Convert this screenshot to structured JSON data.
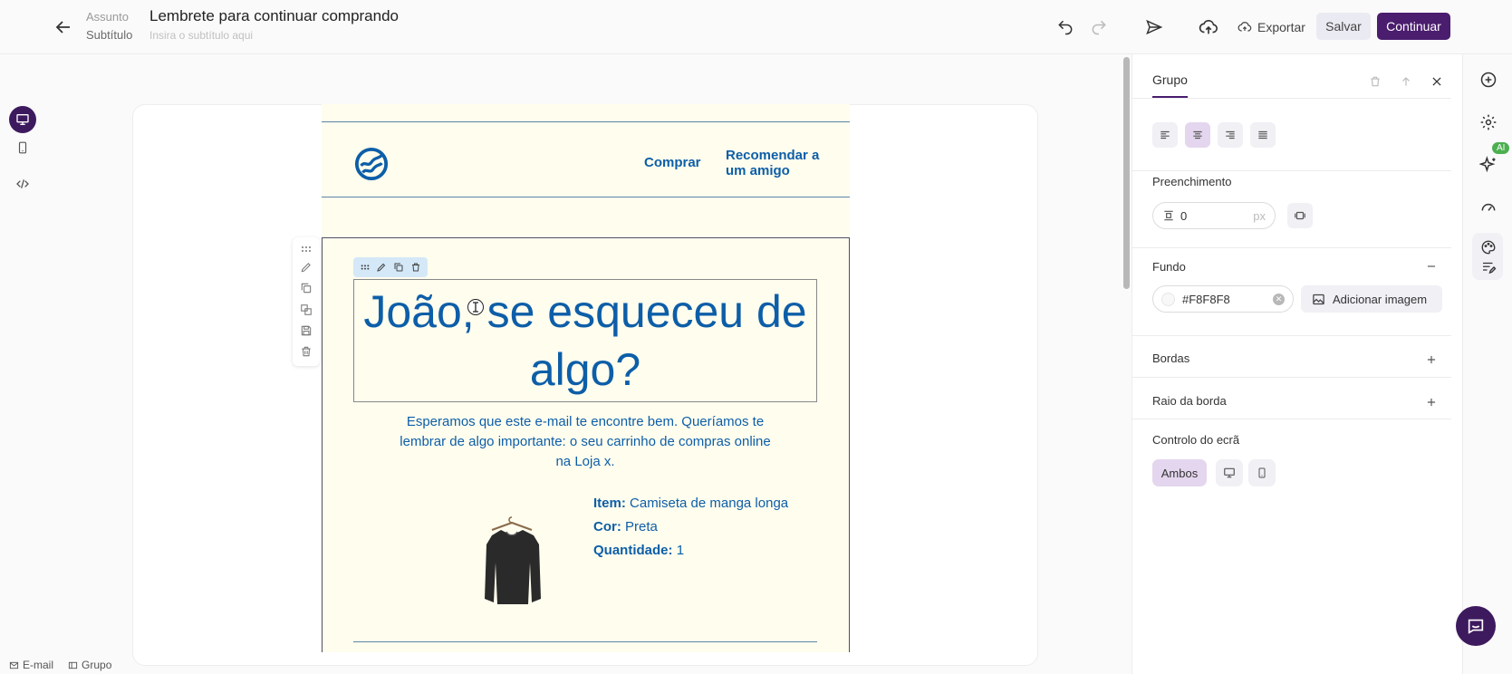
{
  "header": {
    "subject_label": "Assunto",
    "subject_value": "Lembrete para continuar comprando",
    "subtitle_label": "Subtítulo",
    "subtitle_placeholder": "Insira o subtítulo aqui",
    "export_label": "Exportar",
    "save_label": "Salvar",
    "continue_label": "Continuar"
  },
  "email": {
    "nav_comprar": "Comprar",
    "nav_recomendar": "Recomendar a um amigo",
    "heading": "João, se esqueceu de algo?",
    "body": "Esperamos que este e-mail te encontre bem. Queríamos te lembrar de algo importante: o seu carrinho de compras online na Loja x.",
    "item_label": "Item:",
    "item_value": "Camiseta de manga longa",
    "color_label": "Cor:",
    "color_value": "Preta",
    "qty_label": "Quantidade:",
    "qty_value": "1"
  },
  "panel": {
    "tab": "Grupo",
    "padding_label": "Preenchimento",
    "padding_value": "0",
    "padding_unit": "px",
    "background_label": "Fundo",
    "background_color": "#F8F8F8",
    "add_image_label": "Adicionar imagem",
    "borders_label": "Bordas",
    "radius_label": "Raio da borda",
    "screen_label": "Controlo do ecrã",
    "screen_both": "Ambos"
  },
  "right_rail": {
    "ai_badge": "AI"
  },
  "breadcrumbs": {
    "email": "E-mail",
    "group": "Grupo"
  },
  "colors": {
    "brand": "#4a1d6e",
    "email_text": "#0d5ea8",
    "email_bg": "#fffdee",
    "ai_badge": "#4caf50"
  },
  "icons": [
    "back-arrow-icon",
    "undo-icon",
    "redo-icon",
    "send-icon",
    "upload-icon",
    "cloud-upload-icon",
    "desktop-icon",
    "mobile-icon",
    "code-icon",
    "drag-icon",
    "pencil-icon",
    "copy-icon",
    "trash-icon",
    "save-icon",
    "plus-circle-icon",
    "gear-icon",
    "sparkle-icon",
    "speedometer-icon",
    "palette-icon",
    "chat-icon"
  ]
}
